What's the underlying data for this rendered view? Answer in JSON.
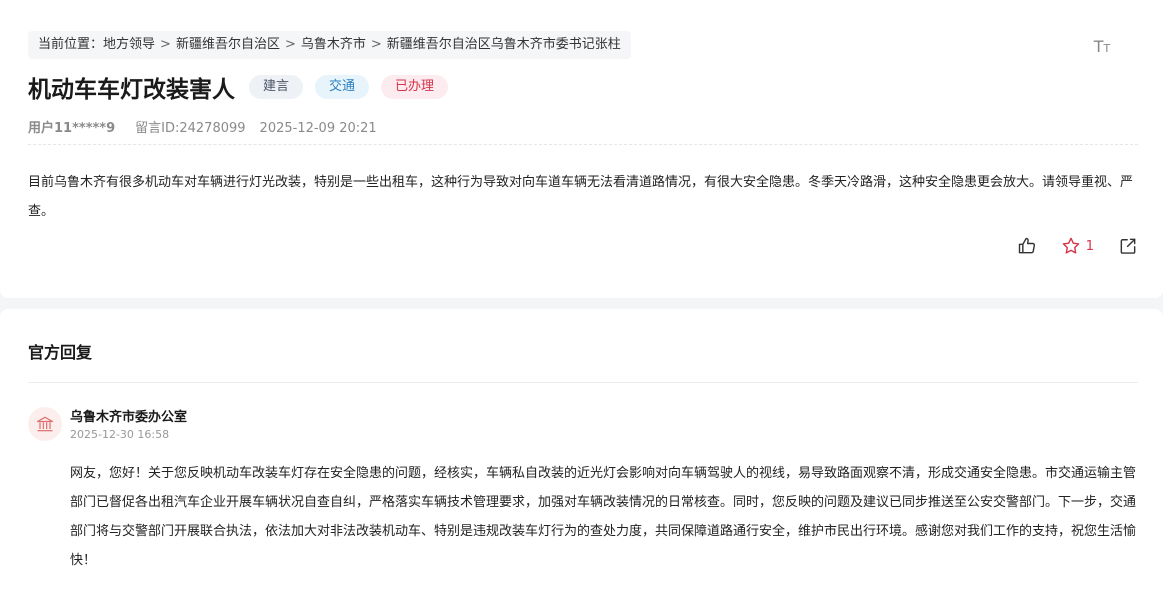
{
  "breadcrumb": {
    "prefix": "当前位置：",
    "items": [
      "地方领导",
      "新疆维吾尔自治区",
      "乌鲁木齐市",
      "新疆维吾尔自治区乌鲁木齐市委书记张柱"
    ],
    "separator": ">"
  },
  "font_size_icon": {
    "big": "T",
    "small": "T"
  },
  "message": {
    "title": "机动车车灯改装害人",
    "tags": [
      "建言",
      "交通",
      "已办理"
    ],
    "user": "用户11*****9",
    "msg_id": "留言ID:24278099",
    "datetime": "2025-12-09 20:21",
    "content": "目前乌鲁木齐有很多机动车对车辆进行灯光改装，特别是一些出租车，这种行为导致对向车道车辆无法看清道路情况，有很大安全隐患。冬季天冷路滑，这种安全隐患更会放大。请领导重视、严查。",
    "star_count": "1"
  },
  "reply": {
    "section_title": "官方回复",
    "org_name": "乌鲁木齐市委办公室",
    "datetime": "2025-12-30 16:58",
    "content": "网友，您好！关于您反映机动车改装车灯存在安全隐患的问题，经核实，车辆私自改装的近光灯会影响对向车辆驾驶人的视线，易导致路面观察不清，形成交通安全隐患。市交通运输主管部门已督促各出租汽车企业开展车辆状况自查自纠，严格落实车辆技术管理要求，加强对车辆改装情况的日常核查。同时，您反映的问题及建议已同步推送至公安交警部门。下一步，交通部门将与交警部门开展联合执法，依法加大对非法改装机动车、特别是违规改装车灯行为的查处力度，共同保障道路通行安全，维护市民出行环境。感谢您对我们工作的支持，祝您生活愉快！"
  },
  "colors": {
    "accent_red": "#d6344a",
    "tag_blue": "#2d7fc1",
    "tag_gray": "#4a5566"
  },
  "icons": [
    "thumbs-up-icon",
    "star-icon",
    "share-icon",
    "font-size-icon",
    "government-building-icon"
  ]
}
